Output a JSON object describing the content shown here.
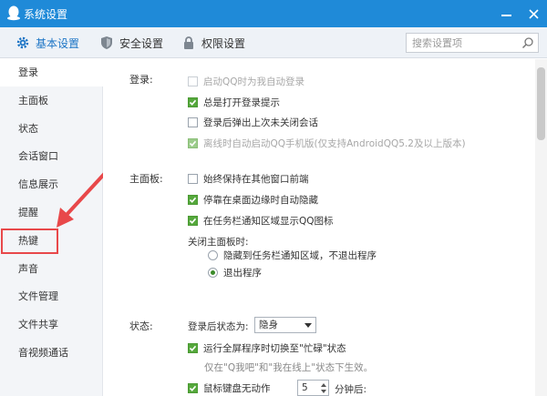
{
  "window": {
    "title": "系统设置"
  },
  "tabs": [
    {
      "label": "基本设置",
      "icon": "gear-icon",
      "active": true
    },
    {
      "label": "安全设置",
      "icon": "shield-icon"
    },
    {
      "label": "权限设置",
      "icon": "lock-icon"
    }
  ],
  "search": {
    "placeholder": "搜索设置项"
  },
  "sidebar": {
    "items": [
      {
        "label": "登录"
      },
      {
        "label": "主面板"
      },
      {
        "label": "状态"
      },
      {
        "label": "会话窗口"
      },
      {
        "label": "信息展示"
      },
      {
        "label": "提醒"
      },
      {
        "label": "热键"
      },
      {
        "label": "声音"
      },
      {
        "label": "文件管理"
      },
      {
        "label": "文件共享"
      },
      {
        "label": "音视频通话"
      }
    ]
  },
  "login": {
    "label": "登录:",
    "options": [
      {
        "label": "启动QQ时为我自动登录",
        "checked": false,
        "disabled": true
      },
      {
        "label": "总是打开登录提示",
        "checked": true
      },
      {
        "label": "登录后弹出上次未关闭会话",
        "checked": false
      },
      {
        "label": "离线时自动启动QQ手机版(仅支持AndroidQQ5.2及以上版本)",
        "checked": true,
        "disabled": true
      }
    ]
  },
  "main_panel": {
    "label": "主面板:",
    "options": [
      {
        "label": "始终保持在其他窗口前端",
        "checked": false
      },
      {
        "label": "停靠在桌面边缘时自动隐藏",
        "checked": true
      },
      {
        "label": "在任务栏通知区域显示QQ图标",
        "checked": true
      }
    ],
    "close_label": "关闭主面板时:",
    "close_options": [
      {
        "label": "隐藏到任务栏通知区域，不退出程序",
        "selected": false
      },
      {
        "label": "退出程序",
        "selected": true
      }
    ]
  },
  "status": {
    "label": "状态:",
    "after_login_label": "登录后状态为:",
    "after_login_value": "隐身",
    "fullscreen_option": {
      "label": "运行全屏程序时切换至\"忙碌\"状态",
      "checked": true
    },
    "fullscreen_note": "仅在\"Q我吧\"和\"我在线上\"状态下生效。",
    "idle_option": {
      "label": "鼠标键盘无动作",
      "checked": true
    },
    "idle_minutes": "5",
    "idle_suffix": "分钟后:"
  },
  "colors": {
    "titlebar": "#1f8ad8",
    "accent": "#1b74c5",
    "checkbox": "#55a83c",
    "highlight": "#e8484a"
  }
}
